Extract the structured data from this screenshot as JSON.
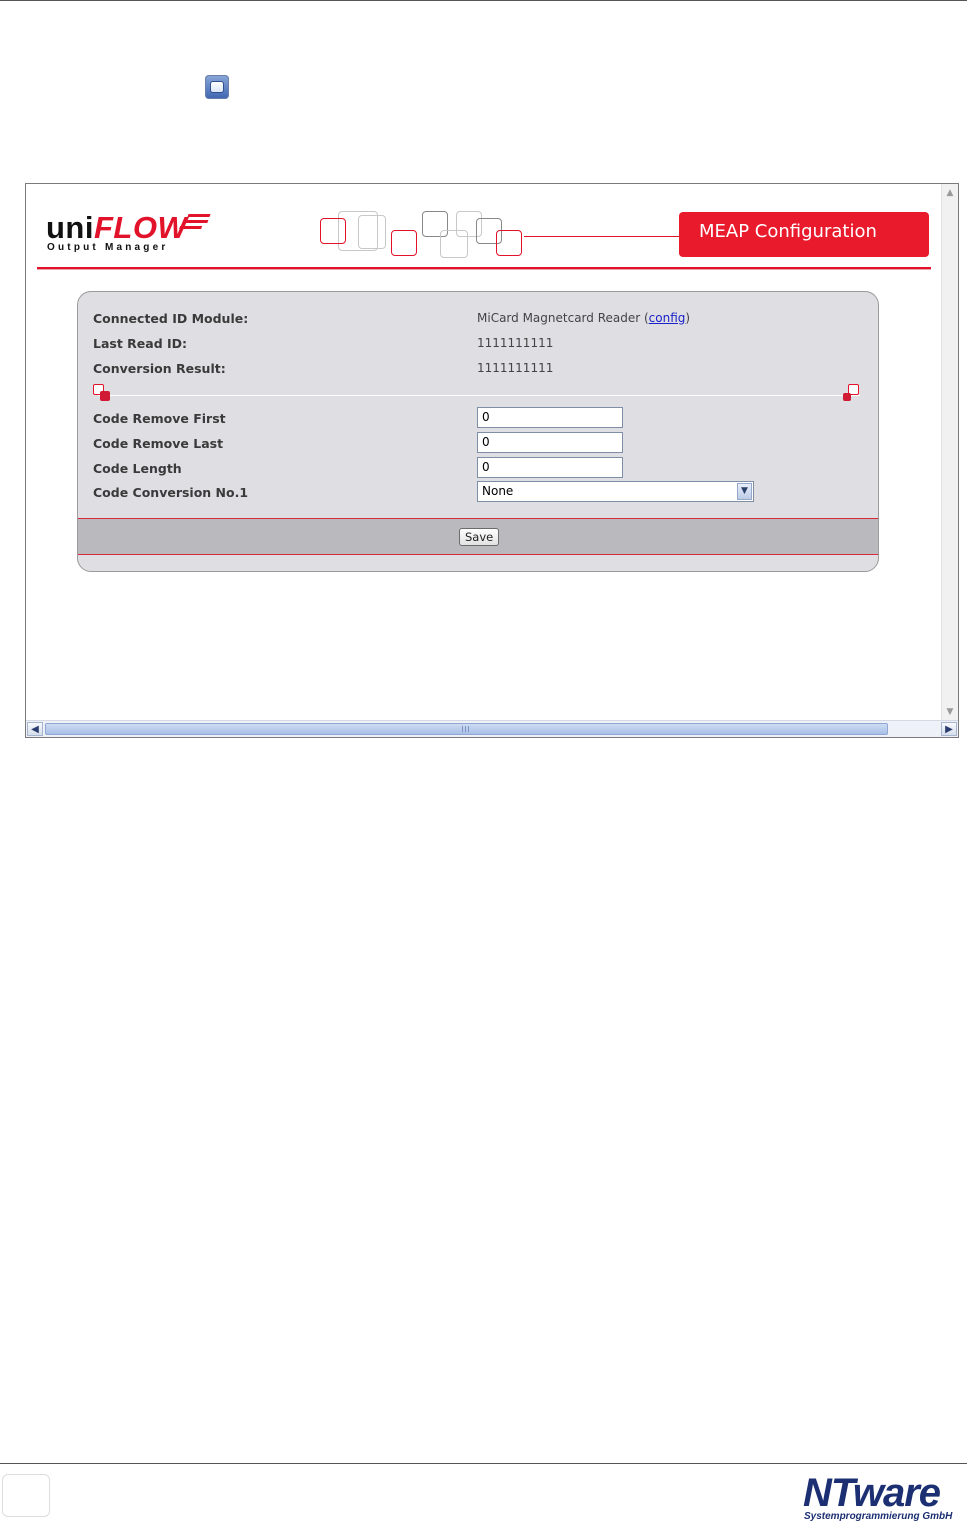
{
  "app": {
    "logo_brand": "uniFLOW",
    "logo_prefix": "uni",
    "logo_suffix": "FLOW",
    "logo_subtitle": "Output Manager",
    "header_badge": "MEAP Configuration"
  },
  "info": {
    "connected_module_label": "Connected ID Module:",
    "connected_module_value": "MiCard Magnetcard Reader (",
    "config_link": "config",
    "connected_module_close": ")",
    "last_read_label": "Last Read ID:",
    "last_read_value": "1111111111",
    "conversion_label": "Conversion Result:",
    "conversion_value": "1111111111"
  },
  "form": {
    "remove_first_label": "Code Remove First",
    "remove_first_value": "0",
    "remove_last_label": "Code Remove Last",
    "remove_last_value": "0",
    "length_label": "Code Length",
    "length_value": "0",
    "conversion_label": "Code Conversion No.1",
    "conversion_selected": "None",
    "save_label": "Save"
  },
  "footer": {
    "company_logo": "NTware",
    "company_subtitle": "Systemprogrammierung GmbH"
  },
  "colors": {
    "brand_red": "#e3122b",
    "brand_navy": "#1b2f72",
    "panel_bg": "#dfdee3"
  },
  "icons": {
    "window_icon": "application-window-icon"
  }
}
